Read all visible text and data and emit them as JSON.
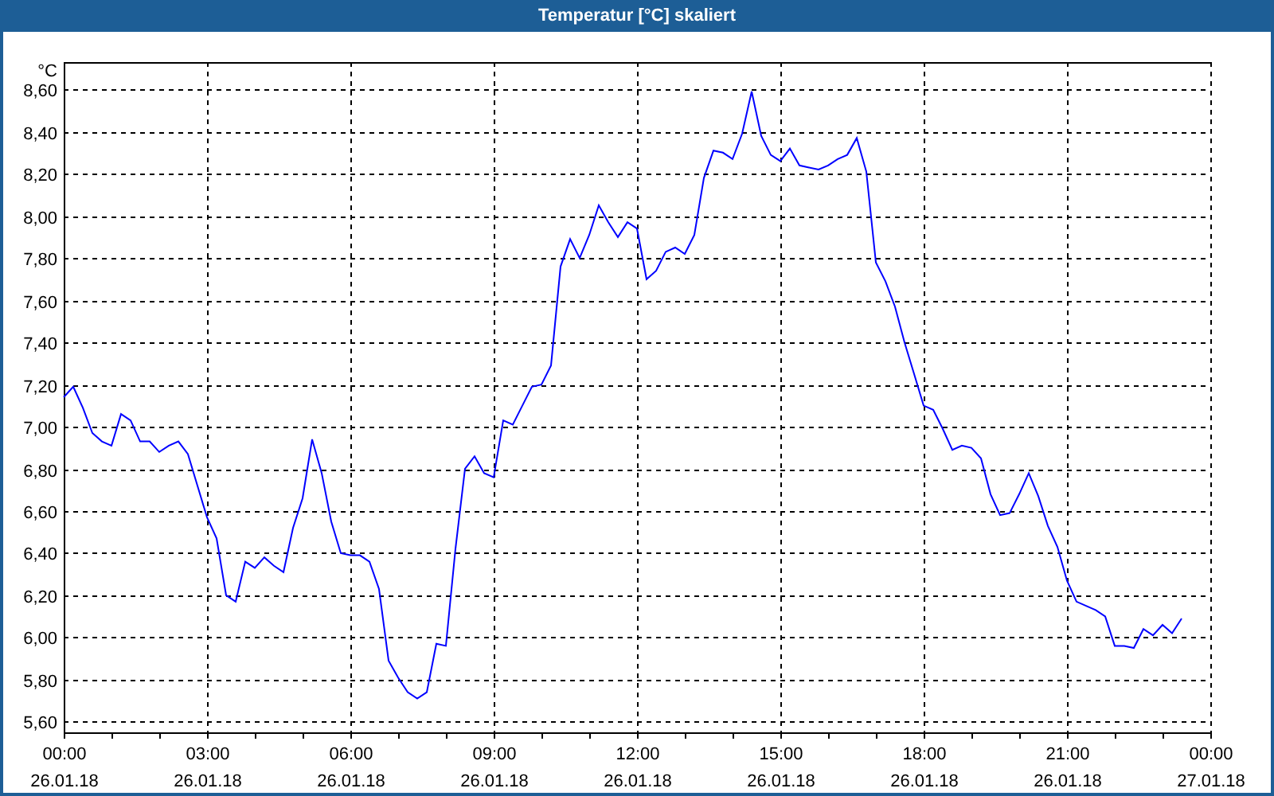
{
  "window": {
    "title": "Temperatur [°C] skaliert"
  },
  "chart": {
    "chart_data": {
      "type": "line",
      "grid": true,
      "ylabel": "°C",
      "ylim": [
        5.55,
        8.73
      ],
      "yticks": [
        {
          "value": 5.6,
          "label": "5,60"
        },
        {
          "value": 5.8,
          "label": "5,80"
        },
        {
          "value": 6.0,
          "label": "6,00"
        },
        {
          "value": 6.2,
          "label": "6,20"
        },
        {
          "value": 6.4,
          "label": "6,40"
        },
        {
          "value": 6.6,
          "label": "6,60"
        },
        {
          "value": 6.8,
          "label": "6,80"
        },
        {
          "value": 7.0,
          "label": "7,00"
        },
        {
          "value": 7.2,
          "label": "7,20"
        },
        {
          "value": 7.4,
          "label": "7,40"
        },
        {
          "value": 7.6,
          "label": "7,60"
        },
        {
          "value": 7.8,
          "label": "7,80"
        },
        {
          "value": 8.0,
          "label": "8,00"
        },
        {
          "value": 8.2,
          "label": "8,20"
        },
        {
          "value": 8.4,
          "label": "8,40"
        },
        {
          "value": 8.6,
          "label": "8,60"
        }
      ],
      "categories": [
        "00:00\n26.01.18",
        null,
        null,
        null,
        null,
        null,
        null,
        null,
        null,
        null,
        null,
        null,
        null,
        null,
        null,
        "03:00\n26.01.18",
        null,
        null,
        null,
        null,
        null,
        null,
        null,
        null,
        null,
        null,
        null,
        null,
        null,
        null,
        "06:00\n26.01.18",
        null,
        null,
        null,
        null,
        null,
        null,
        null,
        null,
        null,
        null,
        null,
        null,
        null,
        null,
        "09:00\n26.01.18",
        null,
        null,
        null,
        null,
        null,
        null,
        null,
        null,
        null,
        null,
        null,
        null,
        null,
        null,
        "12:00\n26.01.18",
        null,
        null,
        null,
        null,
        null,
        null,
        null,
        null,
        null,
        null,
        null,
        null,
        null,
        null,
        "15:00\n26.01.18",
        null,
        null,
        null,
        null,
        null,
        null,
        null,
        null,
        null,
        null,
        null,
        null,
        null,
        null,
        "18:00\n26.01.18",
        null,
        null,
        null,
        null,
        null,
        null,
        null,
        null,
        null,
        null,
        null,
        null,
        null,
        null,
        "21:00\n26.01.18",
        null,
        null,
        null,
        null,
        null,
        null,
        null,
        null,
        null,
        null,
        null,
        null,
        null,
        null,
        "00:00\n27.01.18"
      ],
      "series": [
        {
          "color": "#0000ff",
          "values": [
            7.14,
            7.19,
            7.09,
            6.97,
            6.93,
            6.91,
            7.06,
            7.03,
            6.93,
            6.93,
            6.88,
            6.91,
            6.93,
            6.87,
            6.72,
            6.57,
            6.47,
            6.2,
            6.17,
            6.36,
            6.33,
            6.38,
            6.34,
            6.31,
            6.52,
            6.66,
            6.94,
            6.78,
            6.55,
            6.4,
            6.39,
            6.39,
            6.36,
            6.23,
            5.89,
            5.81,
            5.74,
            5.71,
            5.74,
            5.97,
            5.96,
            6.42,
            6.8,
            6.86,
            6.78,
            6.76,
            7.03,
            7.01,
            7.1,
            7.19,
            7.2,
            7.29,
            7.76,
            7.89,
            7.8,
            7.91,
            8.05,
            7.97,
            7.9,
            7.97,
            7.94,
            7.7,
            7.74,
            7.83,
            7.85,
            7.82,
            7.91,
            8.18,
            8.31,
            8.3,
            8.27,
            8.39,
            8.59,
            8.38,
            8.29,
            8.26,
            8.32,
            8.24,
            8.23,
            8.22,
            8.24,
            8.27,
            8.29,
            8.37,
            8.21,
            7.78,
            7.69,
            7.57,
            7.4,
            7.25,
            7.1,
            7.08,
            6.99,
            6.89,
            6.91,
            6.9,
            6.85,
            6.68,
            6.58,
            6.59,
            6.68,
            6.78,
            6.67,
            6.53,
            6.43,
            6.27,
            6.17,
            6.15,
            6.13,
            6.1,
            5.96,
            5.96,
            5.95,
            6.04,
            6.01,
            6.06,
            6.02,
            6.09,
            null,
            null,
            null
          ]
        }
      ]
    }
  }
}
